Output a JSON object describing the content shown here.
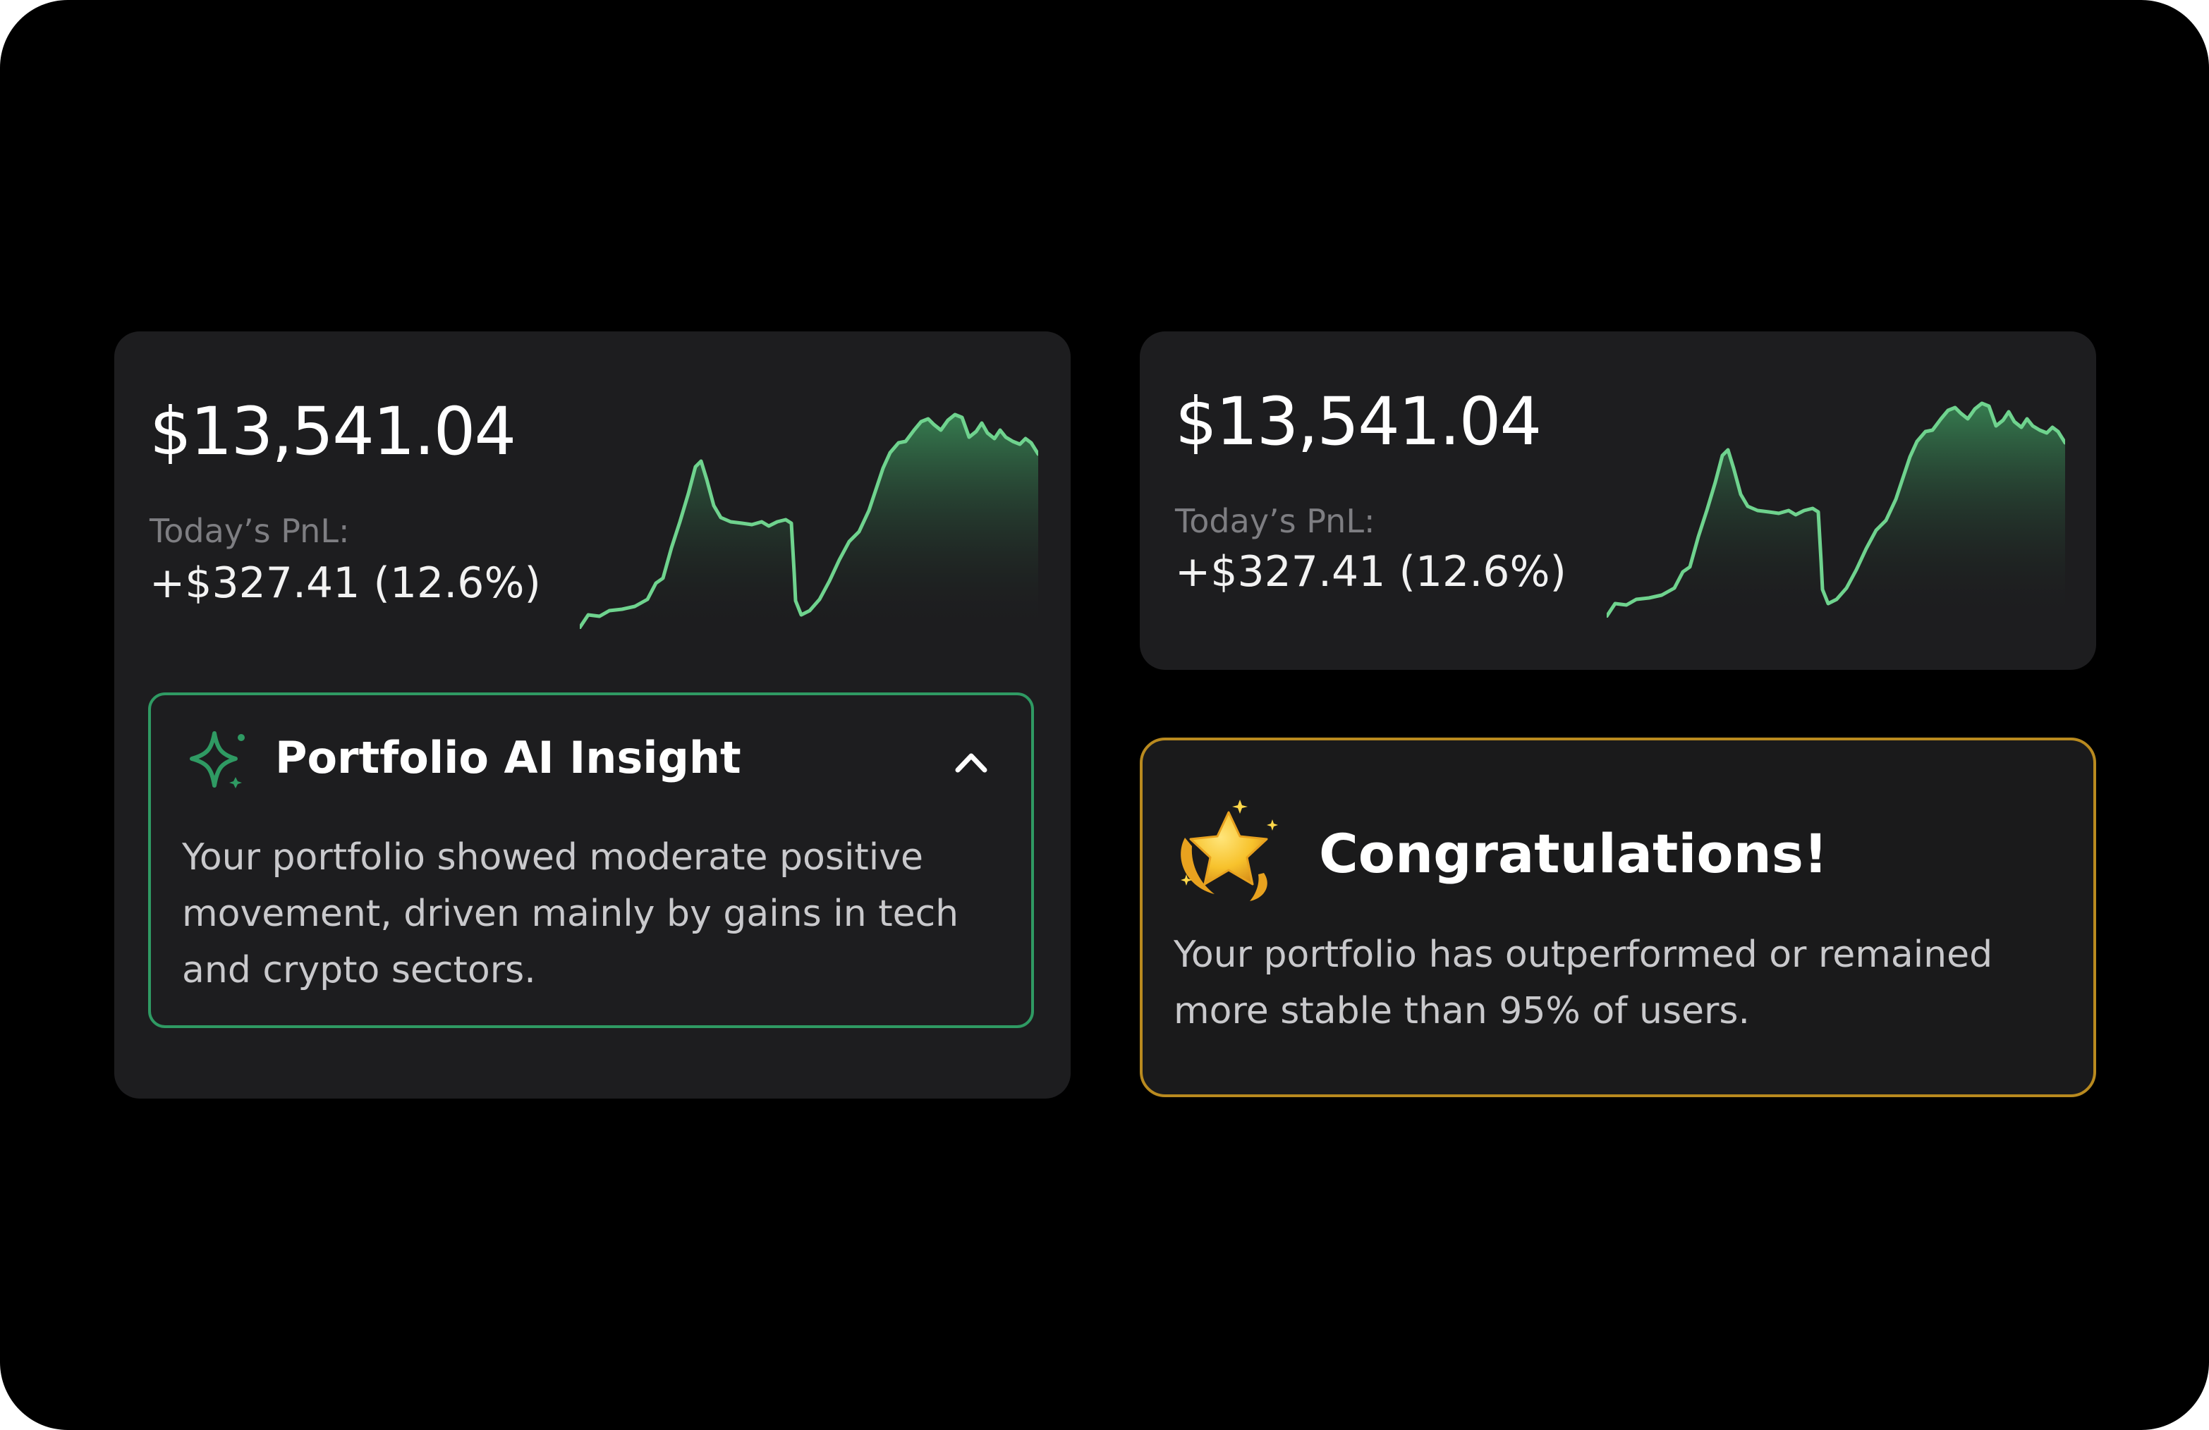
{
  "colors": {
    "background": "#000000",
    "card": "#1d1d1f",
    "accent_green": "#2f9a63",
    "sparkline": "#6fd38e",
    "accent_gold": "#b98a1f"
  },
  "portfolio_cards": [
    {
      "balance": "$13,541.04",
      "pnl_label": "Today’s PnL:",
      "pnl_value": "+$327.41 (12.6%)"
    },
    {
      "balance": "$13,541.04",
      "pnl_label": "Today’s PnL:",
      "pnl_value": "+$327.41 (12.6%)"
    }
  ],
  "insight": {
    "icon": "sparkle-icon",
    "title": "Portfolio AI Insight",
    "toggle_icon": "chevron-up-icon",
    "body_lines": [
      "Your portfolio showed moderate positive",
      "movement, driven mainly by gains in tech",
      "and crypto sectors."
    ]
  },
  "congrats": {
    "icon": "star-trophy-icon",
    "title": "Congratulations!",
    "body_lines": [
      "Your portfolio has outperformed or remained",
      "more stable than 95% of users."
    ]
  }
}
